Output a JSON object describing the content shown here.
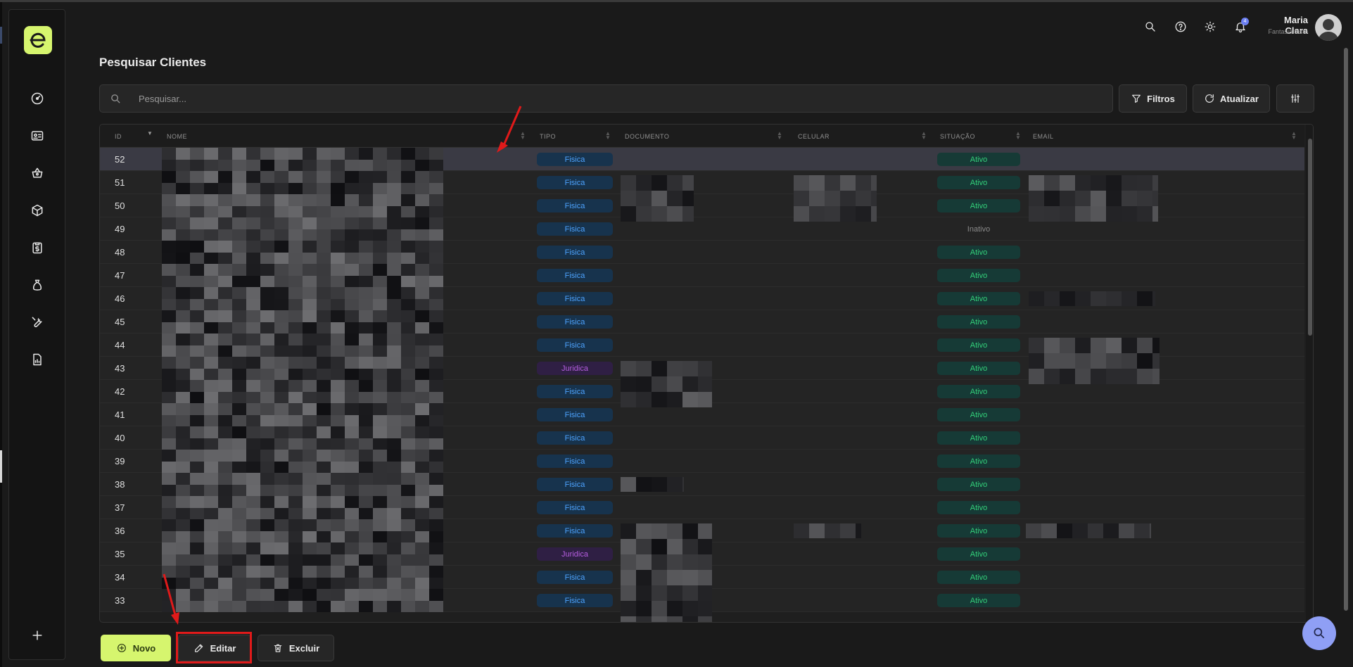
{
  "header": {
    "title": "Pesquisar Clientes",
    "user_name": "Maria Clara",
    "user_company": "Fantasia teste",
    "notification_count": "4"
  },
  "sidebar": {
    "items": [
      {
        "name": "dashboard-icon"
      },
      {
        "name": "id-card-icon"
      },
      {
        "name": "basket-icon"
      },
      {
        "name": "box-icon"
      },
      {
        "name": "clipboard-dollar-icon"
      },
      {
        "name": "money-bag-icon"
      },
      {
        "name": "wrench-icon"
      },
      {
        "name": "report-icon"
      }
    ],
    "add_icon": "plus-icon"
  },
  "search": {
    "placeholder": "Pesquisar..."
  },
  "toolbar": {
    "filters_label": "Filtros",
    "refresh_label": "Atualizar"
  },
  "table": {
    "columns": [
      "ID",
      "NOME",
      "TIPO",
      "DOCUMENTO",
      "CELULAR",
      "SITUAÇÃO",
      "EMAIL"
    ],
    "rows": [
      {
        "id": "52",
        "tipo": "Fisica",
        "situacao": "Ativo"
      },
      {
        "id": "51",
        "tipo": "Fisica",
        "situacao": "Ativo"
      },
      {
        "id": "50",
        "tipo": "Fisica",
        "situacao": "Ativo"
      },
      {
        "id": "49",
        "tipo": "Fisica",
        "situacao": "Inativo"
      },
      {
        "id": "48",
        "tipo": "Fisica",
        "situacao": "Ativo"
      },
      {
        "id": "47",
        "tipo": "Fisica",
        "situacao": "Ativo"
      },
      {
        "id": "46",
        "tipo": "Fisica",
        "situacao": "Ativo"
      },
      {
        "id": "45",
        "tipo": "Fisica",
        "situacao": "Ativo"
      },
      {
        "id": "44",
        "tipo": "Fisica",
        "situacao": "Ativo"
      },
      {
        "id": "43",
        "tipo": "Juridica",
        "situacao": "Ativo"
      },
      {
        "id": "42",
        "tipo": "Fisica",
        "situacao": "Ativo"
      },
      {
        "id": "41",
        "tipo": "Fisica",
        "situacao": "Ativo"
      },
      {
        "id": "40",
        "tipo": "Fisica",
        "situacao": "Ativo"
      },
      {
        "id": "39",
        "tipo": "Fisica",
        "situacao": "Ativo"
      },
      {
        "id": "38",
        "tipo": "Fisica",
        "situacao": "Ativo"
      },
      {
        "id": "37",
        "tipo": "Fisica",
        "situacao": "Ativo"
      },
      {
        "id": "36",
        "tipo": "Fisica",
        "situacao": "Ativo"
      },
      {
        "id": "35",
        "tipo": "Juridica",
        "situacao": "Ativo"
      },
      {
        "id": "34",
        "tipo": "Fisica",
        "situacao": "Ativo"
      },
      {
        "id": "33",
        "tipo": "Fisica",
        "situacao": "Ativo"
      }
    ]
  },
  "actions": {
    "new_label": "Novo",
    "edit_label": "Editar",
    "delete_label": "Excluir"
  },
  "colors": {
    "accent": "#d6f56e",
    "fisica_bg": "#17334d",
    "fisica_text": "#4da3ff",
    "juridica_bg": "#2f1f44",
    "juridica_text": "#b65ee0",
    "ativo_bg": "#163a36",
    "ativo_text": "#33d17a",
    "annotation_red": "#e01a1a"
  }
}
